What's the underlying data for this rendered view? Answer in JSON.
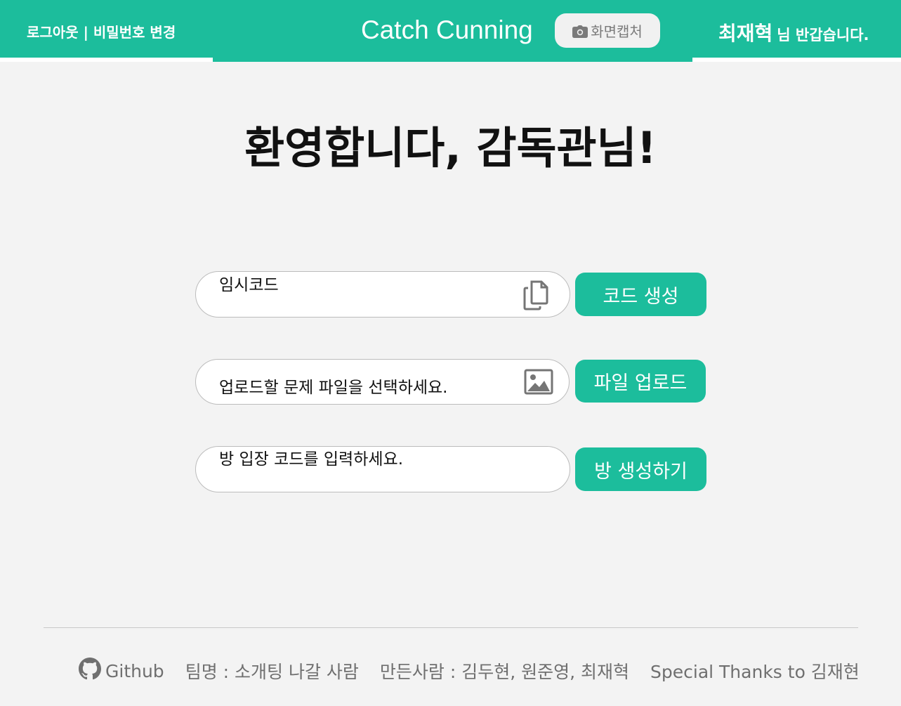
{
  "header": {
    "logout_label": "로그아웃",
    "divider": "|",
    "change_password_label": "비밀번호 변경",
    "app_title": "Catch Cunning",
    "capture_label": "화면캡처",
    "user_name": "최재혁",
    "greeting_suffix": "님 반갑습니다."
  },
  "main": {
    "welcome_title": "환영합니다, 감독관님!",
    "temp_code": {
      "value": "임시코드",
      "icon": "copy-icon",
      "button_label": "코드 생성"
    },
    "upload": {
      "placeholder": "업로드할 문제 파일을 선택하세요.",
      "icon": "image-icon",
      "button_label": "파일 업로드"
    },
    "room": {
      "placeholder": "방 입장 코드를 입력하세요.",
      "button_label": "방 생성하기"
    }
  },
  "footer": {
    "github_label": "Github",
    "github_icon": "github-icon",
    "team_name": "팀명 : 소개팅 나갈 사람",
    "makers": "만든사람 : 김두현, 원준영, 최재혁",
    "thanks": "Special Thanks to 김재현"
  },
  "colors": {
    "accent": "#1cbd9c",
    "background": "#f3f3f3",
    "footer_text": "#6f6f6f"
  }
}
